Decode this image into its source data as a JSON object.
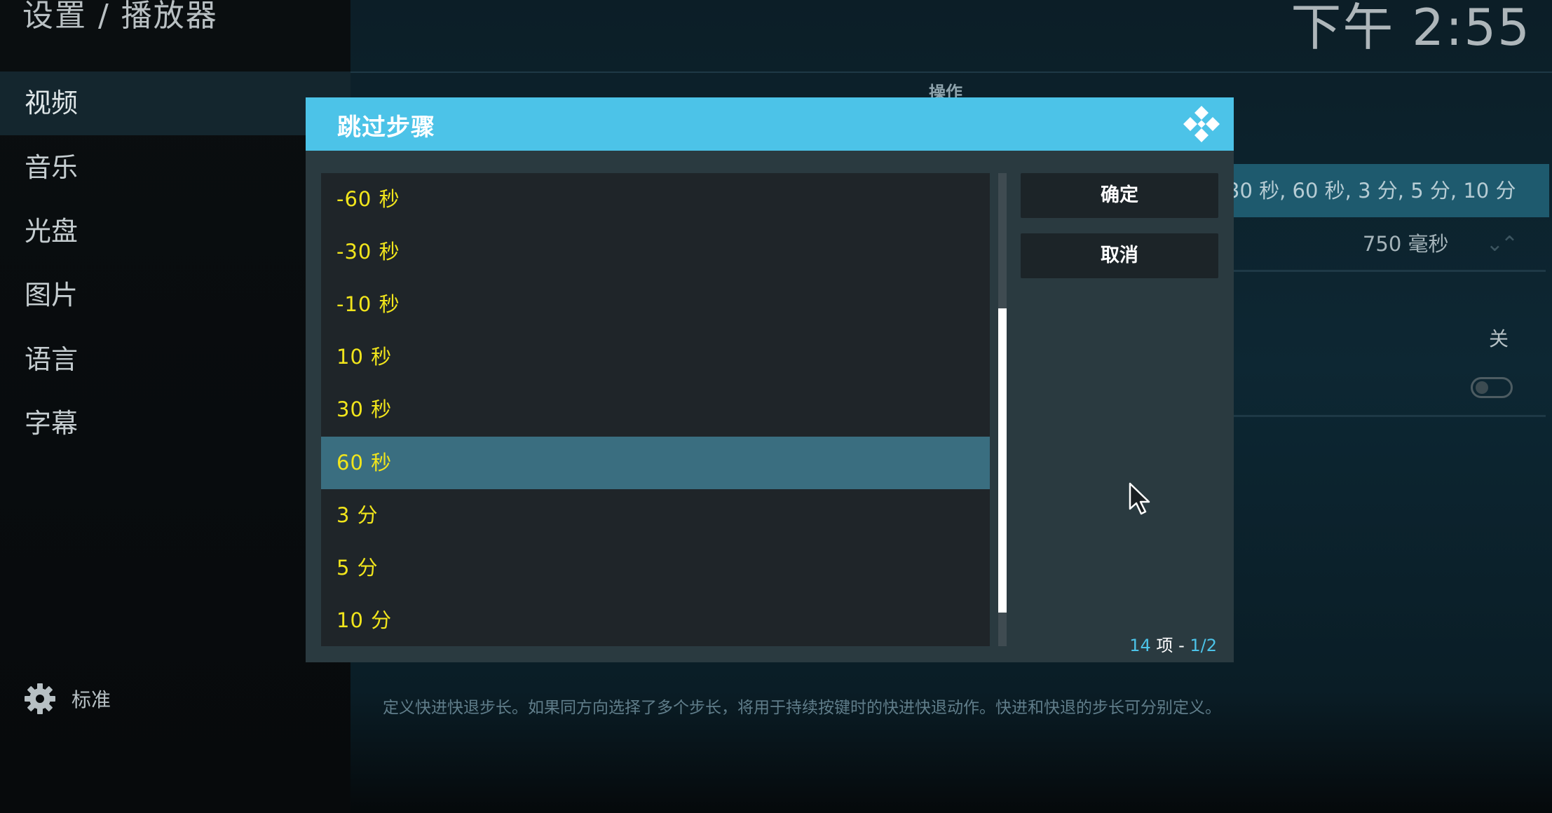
{
  "header": {
    "breadcrumb": "设置 / 播放器",
    "clock": "下午 2:55"
  },
  "sidebar": {
    "items": [
      {
        "label": "视频",
        "active": true
      },
      {
        "label": "音乐",
        "active": false
      },
      {
        "label": "光盘",
        "active": false
      },
      {
        "label": "图片",
        "active": false
      },
      {
        "label": "语言",
        "active": false
      },
      {
        "label": "字幕",
        "active": false
      }
    ],
    "level": {
      "icon": "gear-icon",
      "label": "标准"
    }
  },
  "background": {
    "section_label": "操作",
    "row1_value": "30 秒, 60 秒, 3 分, 5 分, 10 分",
    "row2_value": "750 毫秒",
    "row3_value": "关",
    "description": "定义快进快退步长。如果同方向选择了多个步长，将用于持续按键时的快进快退动作。快进和快退的步长可分别定义。"
  },
  "dialog": {
    "title": "跳过步骤",
    "items": [
      {
        "label": "-60 秒",
        "selected": false
      },
      {
        "label": "-30 秒",
        "selected": false
      },
      {
        "label": "-10 秒",
        "selected": false
      },
      {
        "label": "10 秒",
        "selected": false
      },
      {
        "label": "30 秒",
        "selected": false
      },
      {
        "label": "60 秒",
        "selected": true
      },
      {
        "label": "3 分",
        "selected": false
      },
      {
        "label": "5 分",
        "selected": false
      },
      {
        "label": "10 分",
        "selected": false
      }
    ],
    "ok_label": "确定",
    "cancel_label": "取消",
    "item_count": "14",
    "item_count_suffix": "项",
    "separator": "-",
    "page": "1/2"
  },
  "colors": {
    "accent": "#4cc3e8",
    "list_text": "#f1e51c",
    "selected_row": "#3a6e80",
    "dialog_bg": "#2a3a40"
  }
}
